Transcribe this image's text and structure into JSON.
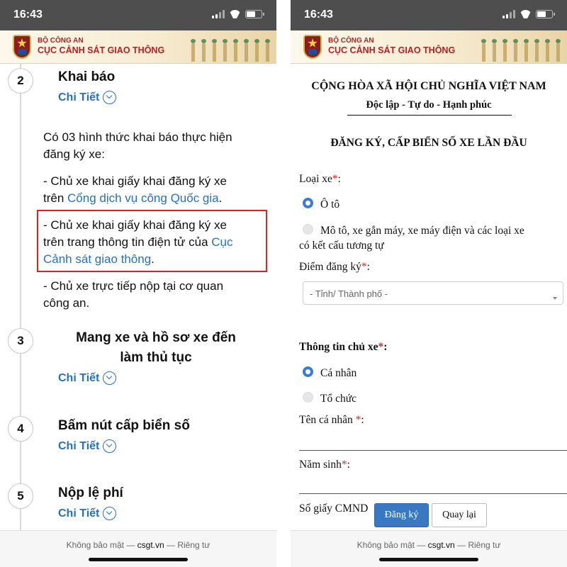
{
  "status_bar": {
    "time": "16:43"
  },
  "banner": {
    "ministry": "BỘ CÔNG AN",
    "department": "CỤC CẢNH SÁT GIAO THÔNG"
  },
  "left_page": {
    "steps": [
      {
        "number": "2",
        "title": "Khai báo",
        "detail": "Chi Tiết"
      },
      {
        "number": "3",
        "title_line1": "Mang xe và hồ sơ xe đến",
        "title_line2": "làm thủ tục",
        "detail": "Chi Tiết"
      },
      {
        "number": "4",
        "title": "Bấm nút cấp biển số",
        "detail": "Chi Tiết"
      },
      {
        "number": "5",
        "title": "Nộp lệ phí",
        "detail": "Chi Tiết"
      }
    ],
    "intro_line1": "Có 03 hình thức khai báo thực hiện",
    "intro_line2": "đăng ký xe:",
    "option1_line1": "- Chủ xe khai giấy khai đăng ký xe",
    "option1_line2_prefix": "trên ",
    "option1_link": "Cổng dịch vụ công Quốc gia",
    "option1_line2_suffix": ".",
    "option2_line1": "- Chủ xe khai giấy khai đăng ký xe",
    "option2_line2_prefix": "trên trang thông tin điện tử của ",
    "option2_link_part1": "Cục",
    "option2_link_part2": "Cảnh sát giao thông",
    "option2_line3_suffix": ".",
    "option3_line1": "- Chủ xe trực tiếp nộp tại cơ quan",
    "option3_line2": "công an."
  },
  "footer": {
    "prefix": "Không bảo mật — ",
    "domain": "csgt.vn",
    "suffix": " — Riêng tư"
  },
  "right_page": {
    "republic": "CỘNG HÒA XÃ HỘI CHỦ NGHĨA VIỆT NAM",
    "motto": "Độc lập - Tự do - Hạnh phúc",
    "form_title": "ĐĂNG KÝ, CẤP BIỂN SỐ XE LẦN ĐẦU",
    "vehicle_type_label": "Loại xe",
    "required_mark": "*",
    "colon": ":",
    "vehicle_options": {
      "car": "Ô tô",
      "moto_line1": "Mô tô, xe gắn máy, xe máy điện và các loại xe",
      "moto_line2": "có kết cấu tương tự"
    },
    "registration_point_label": "Điểm đăng ký",
    "province_placeholder": "- Tỉnh/ Thành phố -",
    "owner_info_label": "Thông tin chủ xe",
    "owner_options": {
      "individual": "Cá nhân",
      "organization": "Tổ chức"
    },
    "individual_name_label": "Tên cá nhân ",
    "birth_year_label": "Năm sinh",
    "id_label": "Số giấy CMND",
    "register_button": "Đăng ký",
    "back_button": "Quay lại"
  },
  "colors": {
    "link": "#2a6fb8",
    "highlight": "#e32020",
    "required": "#d22222",
    "primary_button": "#3a78c4",
    "radio_selected": "#3a7bd5"
  }
}
